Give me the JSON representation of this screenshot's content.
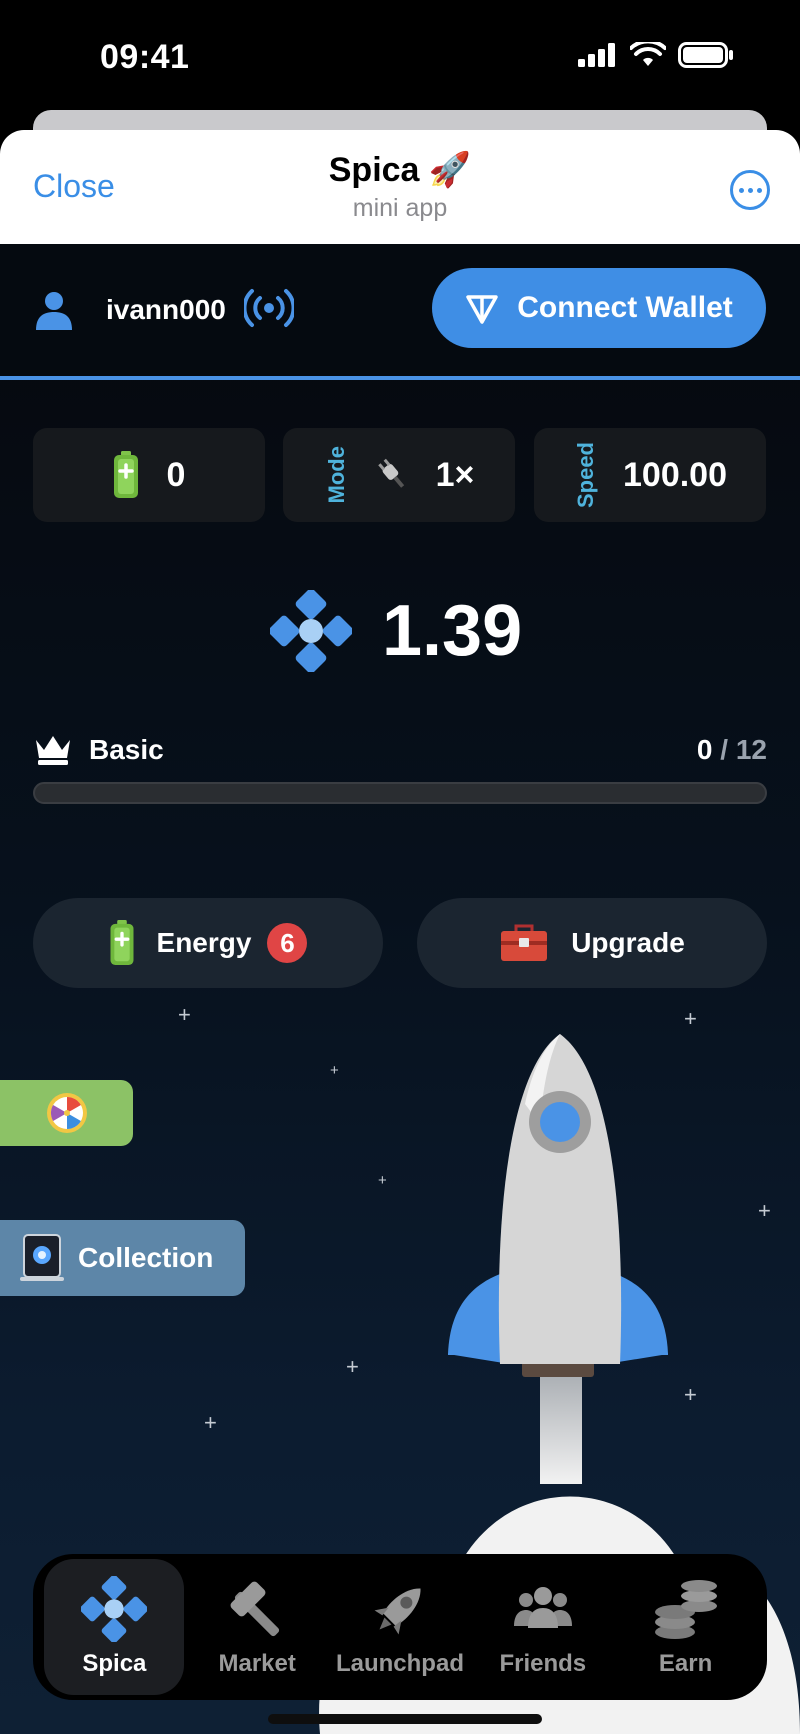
{
  "status_bar": {
    "time": "09:41"
  },
  "header": {
    "close_label": "Close",
    "title": "Spica 🚀",
    "subtitle": "mini app"
  },
  "user": {
    "name": "ivann000"
  },
  "wallet": {
    "button_label": "Connect Wallet"
  },
  "stats": {
    "battery": {
      "value": "0"
    },
    "mode": {
      "label": "Mode",
      "value": "1×"
    },
    "speed": {
      "label": "Speed",
      "value": "100.00"
    }
  },
  "balance": {
    "value": "1.39"
  },
  "rank": {
    "label": "Basic",
    "current": "0",
    "separator": " / ",
    "total": "12",
    "progress_fraction": 0
  },
  "actions": {
    "energy_label": "Energy",
    "energy_count": "6",
    "upgrade_label": "Upgrade"
  },
  "side": {
    "collection_label": "Collection"
  },
  "nav": {
    "items": [
      {
        "label": "Spica",
        "icon": "spica-diamond-icon",
        "active": true
      },
      {
        "label": "Market",
        "icon": "hammer-icon",
        "active": false
      },
      {
        "label": "Launchpad",
        "icon": "rocket-icon",
        "active": false
      },
      {
        "label": "Friends",
        "icon": "people-icon",
        "active": false
      },
      {
        "label": "Earn",
        "icon": "coins-icon",
        "active": false
      }
    ]
  },
  "colors": {
    "accent": "#4a93e6",
    "mode_label": "#4fb3dc",
    "badge": "#e04545",
    "wheel_tab": "#8cc266",
    "collection_tab": "#5d86a8"
  }
}
